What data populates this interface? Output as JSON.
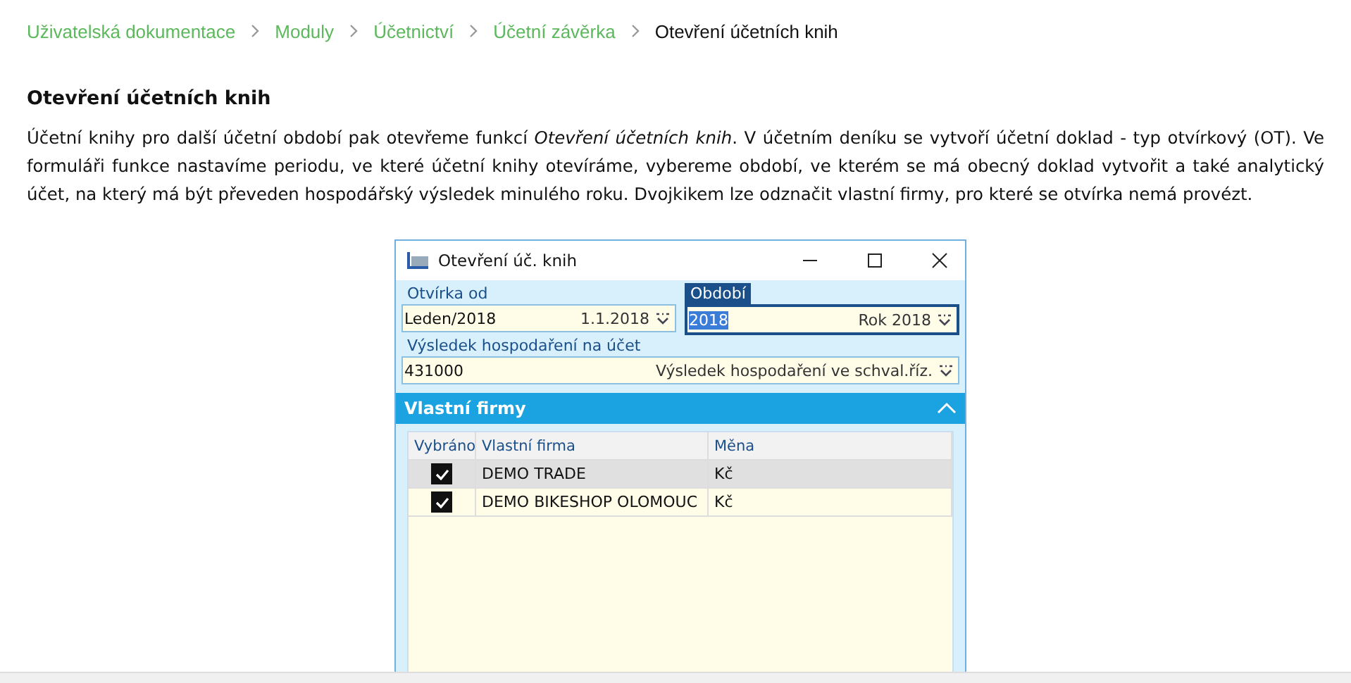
{
  "breadcrumb": [
    {
      "label": "Uživatelská dokumentace",
      "current": false
    },
    {
      "label": "Moduly",
      "current": false
    },
    {
      "label": "Účetnictví",
      "current": false
    },
    {
      "label": "Účetní závěrka",
      "current": false
    },
    {
      "label": "Otevření účetních knih",
      "current": true
    }
  ],
  "heading": "Otevření účetních knih",
  "paragraph": "Účetní knihy pro další účetní období pak otevřeme funkcí *Otevření účetních knih*. V účetním deníku se vytvoří účetní doklad - typ otvírkový (OT). Ve formuláři funkce nastavíme periodu, ve které účetní knihy otevíráme, vybereme období, ve kterém se má obecný doklad vytvořit a také analytický účet, na který má být převeden hospodářský výsledek minulého roku. Dvojkikem lze odznačit vlastní firmy, pro které se otvírka nemá provézt.",
  "dialog": {
    "title": "Otevření úč. knih",
    "fields": [
      {
        "label": "Otvírka od",
        "value": "Leden/2018",
        "hint": "1.1.2018",
        "focused": false
      },
      {
        "label": "Období",
        "value": "2018",
        "hint": "Rok 2018",
        "focused": true
      }
    ],
    "account": {
      "label": "Výsledek hospodaření na účet",
      "value": "431000",
      "hint": "Výsledek hospodaření ve schval.říz."
    },
    "section": {
      "title": "Vlastní firmy",
      "expanded": true
    },
    "table": {
      "columns": [
        "Vybráno",
        "Vlastní firma",
        "Měna"
      ],
      "rows": [
        {
          "checked": true,
          "company": "DEMO TRADE",
          "currency": "Kč",
          "selected": true
        },
        {
          "checked": true,
          "company": "DEMO BIKESHOP OLOMOUC",
          "currency": "Kč",
          "selected": false
        }
      ]
    }
  }
}
